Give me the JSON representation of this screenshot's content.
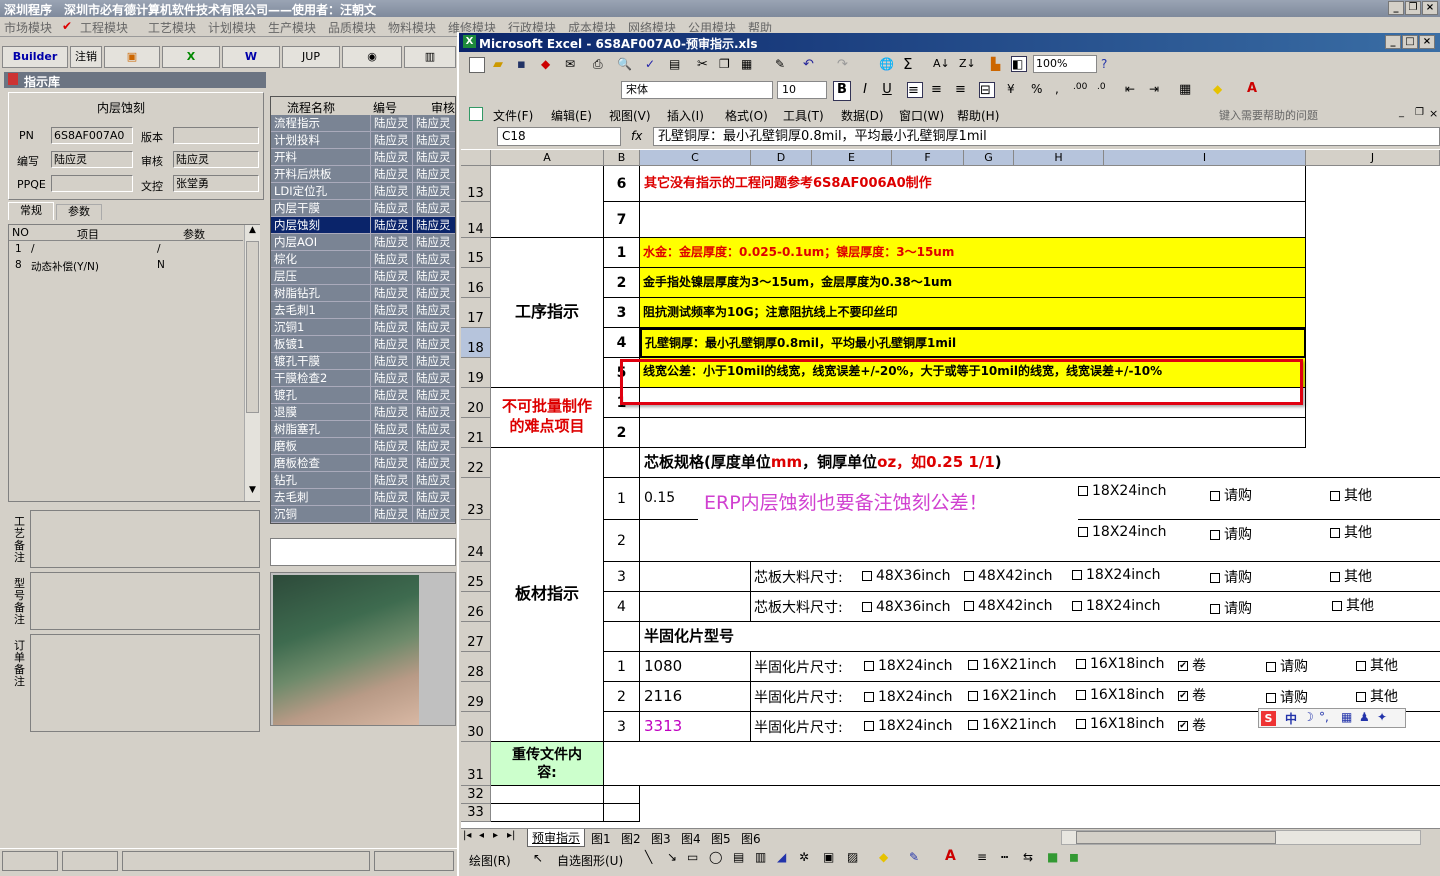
{
  "app_title": "深圳程序　深圳市必有德计算机软件技术有限公司——使用者：汪朝文",
  "main_menu": [
    "市场模块",
    "工程模块",
    "工艺模块",
    "计划模块",
    "生产模块",
    "品质模块",
    "物料模块",
    "维修模块",
    "行政模块",
    "成本模块",
    "网络模块",
    "公用模块",
    "帮助"
  ],
  "toolbar": {
    "builder": "Builder",
    "logout": "注销",
    "jup": "JUP"
  },
  "panel_title": "指示库",
  "form": {
    "heading": "内层蚀刻",
    "pn_label": "PN",
    "pn": "6S8AF007A0",
    "version_label": "版本",
    "version": "",
    "author_label": "编写",
    "author": "陆应灵",
    "review_label": "审核",
    "review": "陆应灵",
    "ppqe_label": "PPQE",
    "ppqe": "",
    "control_label": "文控",
    "control": "张堂勇"
  },
  "tabs": [
    "常规",
    "参数"
  ],
  "param_headers": [
    "NO",
    "项目",
    "参数"
  ],
  "params": [
    {
      "no": "1",
      "item": "/",
      "val": "/"
    },
    {
      "no": "8",
      "item": "动态补偿(Y/N)",
      "val": "N"
    }
  ],
  "notes": [
    "工艺备注",
    "型号备注",
    "订单备注"
  ],
  "process_headers": [
    "流程名称",
    "编号",
    "审核"
  ],
  "process_rows": [
    [
      "流程指示",
      "陆应灵",
      "陆应灵"
    ],
    [
      "计划投料",
      "陆应灵",
      "陆应灵"
    ],
    [
      "开料",
      "陆应灵",
      "陆应灵"
    ],
    [
      "开料后烘板",
      "陆应灵",
      "陆应灵"
    ],
    [
      "LDI定位孔",
      "陆应灵",
      "陆应灵"
    ],
    [
      "内层干膜",
      "陆应灵",
      "陆应灵"
    ],
    [
      "内层蚀刻",
      "陆应灵",
      "陆应灵"
    ],
    [
      "内层AOI",
      "陆应灵",
      "陆应灵"
    ],
    [
      "棕化",
      "陆应灵",
      "陆应灵"
    ],
    [
      "层压",
      "陆应灵",
      "陆应灵"
    ],
    [
      "树脂钻孔",
      "陆应灵",
      "陆应灵"
    ],
    [
      "去毛刺1",
      "陆应灵",
      "陆应灵"
    ],
    [
      "沉铜1",
      "陆应灵",
      "陆应灵"
    ],
    [
      "板镀1",
      "陆应灵",
      "陆应灵"
    ],
    [
      "镀孔干膜",
      "陆应灵",
      "陆应灵"
    ],
    [
      "干膜检查2",
      "陆应灵",
      "陆应灵"
    ],
    [
      "镀孔",
      "陆应灵",
      "陆应灵"
    ],
    [
      "退膜",
      "陆应灵",
      "陆应灵"
    ],
    [
      "树脂塞孔",
      "陆应灵",
      "陆应灵"
    ],
    [
      "磨板",
      "陆应灵",
      "陆应灵"
    ],
    [
      "磨板检查",
      "陆应灵",
      "陆应灵"
    ],
    [
      "钻孔",
      "陆应灵",
      "陆应灵"
    ],
    [
      "去毛刺",
      "陆应灵",
      "陆应灵"
    ],
    [
      "沉铜",
      "陆应灵",
      "陆应灵"
    ]
  ],
  "excel": {
    "title": "Microsoft Excel - 6S8AF007A0-预审指示.xls",
    "font": "宋体",
    "size": "10",
    "zoom": "100%",
    "menu": [
      "文件(F)",
      "编辑(E)",
      "视图(V)",
      "插入(I)",
      "格式(O)",
      "工具(T)",
      "数据(D)",
      "窗口(W)",
      "帮助(H)"
    ],
    "help_placeholder": "键入需要帮助的问题",
    "name_box": "C18",
    "formula": "孔壁铜厚：最小孔壁铜厚0.8mil，平均最小孔壁铜厚1mil",
    "cols": [
      "A",
      "B",
      "C",
      "D",
      "E",
      "F",
      "G",
      "H",
      "I",
      "J"
    ],
    "rows": [
      "13",
      "14",
      "15",
      "16",
      "17",
      "18",
      "19",
      "20",
      "21",
      "22",
      "23",
      "24",
      "25",
      "26",
      "27",
      "28",
      "29",
      "30",
      "31",
      "32",
      "33"
    ],
    "r13_num": "6",
    "r13_text": "其它没有指示的工程问题参考6S8AF006A0制作",
    "r14_num": "7",
    "section_process": "工序指示",
    "p1_num": "1",
    "p1": "水金：金层厚度：0.025-0.1um；镍层厚度：3～15um",
    "p2_num": "2",
    "p2": "金手指处镍层厚度为3～15um，金层厚度为0.38～1um",
    "p3_num": "3",
    "p3": "阻抗测试频率为10G；注意阻抗线上不要印丝印",
    "p4_num": "4",
    "p4": "孔壁铜厚：最小孔壁铜厚0.8mil，平均最小孔壁铜厚1mil",
    "p5_num": "5",
    "p5": "线宽公差：小于10mil的线宽，线宽误差+/-20%，大于或等于10mil的线宽，线宽误差+/-10%",
    "section_difficult": "不可批量制作的难点项目",
    "d1_num": "1",
    "d2_num": "2",
    "section_board": "板材指示",
    "core_spec": "芯板规格(厚度单位",
    "core_spec_mm": "mm",
    "core_spec_2": "，铜厚单位",
    "core_spec_oz": "oz，如0.25 1/1",
    "core_spec_end": ")",
    "b1_num": "1",
    "b1_val": "0.15",
    "b2_num": "2",
    "b3_num": "3",
    "b4_num": "4",
    "annotation": "ERP内层蚀刻也要备注蚀刻公差！",
    "core_size_label": "芯板大料尺寸:",
    "opt_48x36": "48X36inch",
    "opt_48x42": "48X42inch",
    "opt_18x24": "18X24inch",
    "opt_buy": "请购",
    "opt_other": "其他",
    "prepreg_title": "半固化片型号",
    "pp1_num": "1",
    "pp1": "1080",
    "pp2_num": "2",
    "pp2": "2116",
    "pp3_num": "3",
    "pp3": "3313",
    "pp_label": "半固化片尺寸:",
    "opt_16x21": "16X21inch",
    "opt_16x18": "16X18inch",
    "opt_roll": "卷",
    "reupload": "重传文件内容:",
    "sheet_tabs": [
      "预审指示",
      "图1",
      "图2",
      "图3",
      "图4",
      "图5",
      "图6"
    ],
    "draw": "绘图(R)",
    "autoshape": "自选图形(U)",
    "ime": "中"
  }
}
